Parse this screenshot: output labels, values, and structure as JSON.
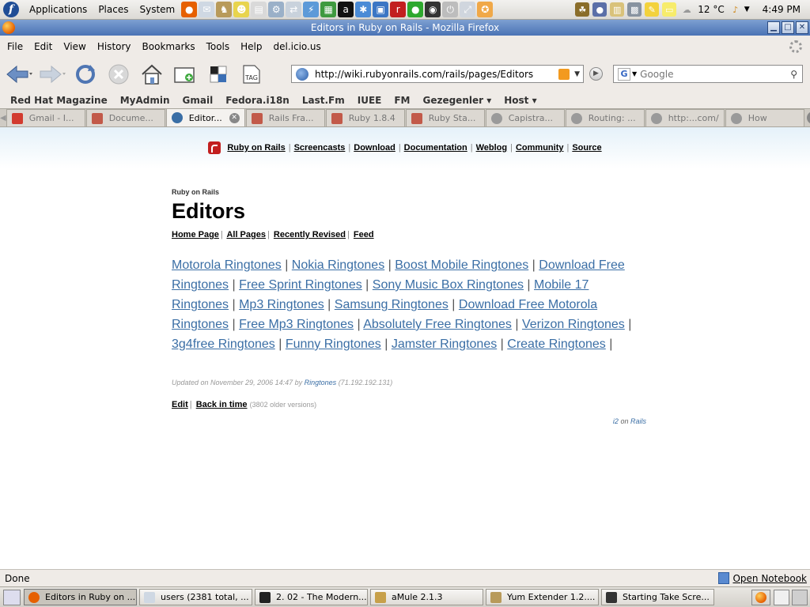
{
  "top_panel": {
    "menus": [
      "Applications",
      "Places",
      "System"
    ],
    "launchers": [
      {
        "icon": "firefox-icon",
        "color": "#e66000",
        "glyph": "●"
      },
      {
        "icon": "mail-icon",
        "color": "#cfd8e3",
        "glyph": "✉"
      },
      {
        "icon": "gnu-icon",
        "color": "#b89a5a",
        "glyph": "♞"
      },
      {
        "icon": "people-icon",
        "color": "#e8d44d",
        "glyph": "☻"
      },
      {
        "icon": "document-icon",
        "color": "#d9d9d9",
        "glyph": "▤"
      },
      {
        "icon": "tools-icon",
        "color": "#9ab0c8",
        "glyph": "⚙"
      },
      {
        "icon": "network-icon",
        "color": "#c9d2dc",
        "glyph": "⇄"
      },
      {
        "icon": "lightning-icon",
        "color": "#5d9ad8",
        "glyph": "⚡"
      },
      {
        "icon": "monitor-icon",
        "color": "#3f9a3f",
        "glyph": "▦"
      },
      {
        "icon": "amazon-icon",
        "color": "#111111",
        "glyph": "a"
      },
      {
        "icon": "messenger-icon",
        "color": "#4a8bd6",
        "glyph": "✱"
      },
      {
        "icon": "screen-icon",
        "color": "#3b76c4",
        "glyph": "▣"
      },
      {
        "icon": "rails-icon",
        "color": "#c21f1f",
        "glyph": "r"
      },
      {
        "icon": "globe-icon",
        "color": "#2ea82e",
        "glyph": "●"
      },
      {
        "icon": "camera-icon",
        "color": "#333333",
        "glyph": "◉"
      },
      {
        "icon": "power-icon",
        "color": "#bdbdbd",
        "glyph": "⏻"
      },
      {
        "icon": "screenshot-icon",
        "color": "#d0d6de",
        "glyph": "⤢"
      },
      {
        "icon": "fish-icon",
        "color": "#f0a848",
        "glyph": "✪"
      }
    ],
    "tray": [
      {
        "icon": "gecko-icon",
        "color": "#8a6d2a",
        "glyph": "☘"
      },
      {
        "icon": "pidgin-icon",
        "color": "#5b6fa8",
        "glyph": "●"
      },
      {
        "icon": "clipboard-icon",
        "color": "#d9c27a",
        "glyph": "▥"
      },
      {
        "icon": "network-tray-icon",
        "color": "#8893a0",
        "glyph": "▩"
      },
      {
        "icon": "note-icon",
        "color": "#f3d23c",
        "glyph": "✎"
      },
      {
        "icon": "sticky-icon",
        "color": "#f7ec6b",
        "glyph": "▭"
      }
    ],
    "weather": "12 °C",
    "clock": "4:49 PM"
  },
  "window": {
    "title": "Editors in Ruby on Rails - Mozilla Firefox",
    "minimize": "▁",
    "maximize": "□",
    "close": "✕"
  },
  "menubar": [
    "File",
    "Edit",
    "View",
    "History",
    "Bookmarks",
    "Tools",
    "Help",
    "del.icio.us"
  ],
  "navbar": {
    "url": "http://wiki.rubyonrails.com/rails/pages/Editors",
    "search_placeholder": "Google"
  },
  "bookmarks": [
    "Red Hat Magazine",
    "MyAdmin",
    "Gmail",
    "Fedora.i18n",
    "Last.Fm",
    "IUEE",
    "FM",
    "Gezegenler ▾",
    "Host ▾"
  ],
  "tabs": [
    {
      "label": "Gmail - I...",
      "color": "#d23b2f",
      "active": false
    },
    {
      "label": "Docume...",
      "color": "#c25a4a",
      "active": false
    },
    {
      "label": "Editor...",
      "color": "#3a6ea5",
      "active": true
    },
    {
      "label": "Rails Fra...",
      "color": "#c25a4a",
      "active": false
    },
    {
      "label": "Ruby 1.8.4",
      "color": "#c25a4a",
      "active": false
    },
    {
      "label": "Ruby Sta...",
      "color": "#c25a4a",
      "active": false
    },
    {
      "label": "Capistra...",
      "color": "#9a9a9a",
      "active": false
    },
    {
      "label": "Routing: ...",
      "color": "#9a9a9a",
      "active": false
    },
    {
      "label": "http:...com/",
      "color": "#9a9a9a",
      "active": false
    },
    {
      "label": "How",
      "color": "#9a9a9a",
      "active": false
    }
  ],
  "site_nav": [
    "Ruby on Rails",
    "Screencasts",
    "Download",
    "Documentation",
    "Weblog",
    "Community",
    "Source"
  ],
  "page": {
    "crumb": "Ruby on Rails",
    "title": "Editors",
    "wiki_nav": [
      "Home Page",
      "All Pages",
      "Recently Revised",
      "Feed"
    ],
    "spam_links": [
      "Motorola Ringtones",
      "Nokia Ringtones",
      "Boost Mobile Ringtones",
      "Download Free Ringtones",
      "Free Sprint Ringtones",
      "Sony Music Box Ringtones",
      "Mobile 17 Ringtones",
      "Mp3 Ringtones",
      "Samsung Ringtones",
      "Download Free Motorola Ringtones",
      "Free Mp3 Ringtones",
      "Absolutely Free Ringtones",
      "Verizon Ringtones",
      "3g4free Ringtones",
      "Funny Ringtones",
      "Jamster Ringtones",
      "Create Ringtones"
    ],
    "updated_prefix": "Updated on November 29, 2006 14:47 by",
    "updated_author": "Ringtones",
    "updated_ip": "(71.192.192.131)",
    "edit": "Edit",
    "back_in_time": "Back in time",
    "older_versions": "(3802 older versions)",
    "credit_link1": "i2",
    "credit_on": "on",
    "credit_link2": "Rails"
  },
  "status": {
    "text": "Done",
    "notebook": "Open Notebook"
  },
  "taskbar": [
    {
      "label": "Editors in Ruby on ...",
      "color": "#e66000",
      "active": true
    },
    {
      "label": "users (2381 total, ...",
      "color": "#cfd8e3",
      "active": false
    },
    {
      "label": "2. 02 - The Modern...",
      "color": "#222222",
      "active": false
    },
    {
      "label": "aMule 2.1.3",
      "color": "#c7a04a",
      "active": false
    },
    {
      "label": "Yum Extender 1.2....",
      "color": "#b89a5a",
      "active": false
    },
    {
      "label": "Starting Take Scre...",
      "color": "#333333",
      "active": false
    }
  ]
}
